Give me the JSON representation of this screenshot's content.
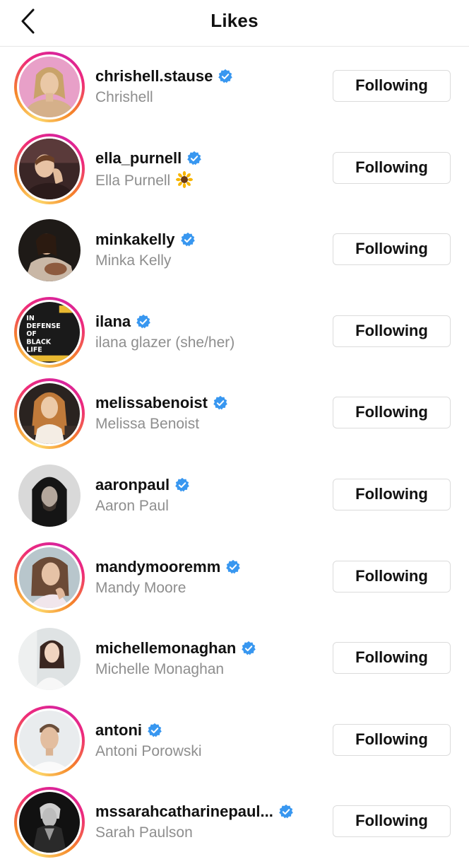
{
  "header": {
    "title": "Likes",
    "back_icon": "chevron-left-icon"
  },
  "colors": {
    "verified": "#3897f0",
    "secondary_text": "#8e8e8e",
    "button_border": "#dbdbdb",
    "story_ring": [
      "#fdd86a",
      "#f58529",
      "#ee2a7b",
      "#d6249f"
    ]
  },
  "users": [
    {
      "username": "chrishell.stause",
      "full_name": "Chrishell",
      "verified": true,
      "story_ring": true,
      "button": "Following"
    },
    {
      "username": "ella_purnell",
      "full_name": "Ella Purnell",
      "full_name_emoji": "sunflower-emoji",
      "verified": true,
      "story_ring": true,
      "button": "Following"
    },
    {
      "username": "minkakelly",
      "full_name": "Minka Kelly",
      "verified": true,
      "story_ring": false,
      "button": "Following"
    },
    {
      "username": "ilana",
      "full_name": "ilana glazer (she/her)",
      "verified": true,
      "story_ring": true,
      "button": "Following",
      "avatar_text": "IN DEFENSE OF BLACK LIFE"
    },
    {
      "username": "melissabenoist",
      "full_name": "Melissa Benoist",
      "verified": true,
      "story_ring": true,
      "button": "Following"
    },
    {
      "username": "aaronpaul",
      "full_name": "Aaron Paul",
      "verified": true,
      "story_ring": false,
      "button": "Following"
    },
    {
      "username": "mandymooremm",
      "full_name": "Mandy Moore",
      "verified": true,
      "story_ring": true,
      "button": "Following"
    },
    {
      "username": "michellemonaghan",
      "full_name": "Michelle Monaghan",
      "verified": true,
      "story_ring": false,
      "button": "Following"
    },
    {
      "username": "antoni",
      "full_name": "Antoni Porowski",
      "verified": true,
      "story_ring": true,
      "button": "Following"
    },
    {
      "username": "mssarahcatharinepaul...",
      "full_name": "Sarah Paulson",
      "verified": true,
      "story_ring": true,
      "button": "Following"
    }
  ]
}
